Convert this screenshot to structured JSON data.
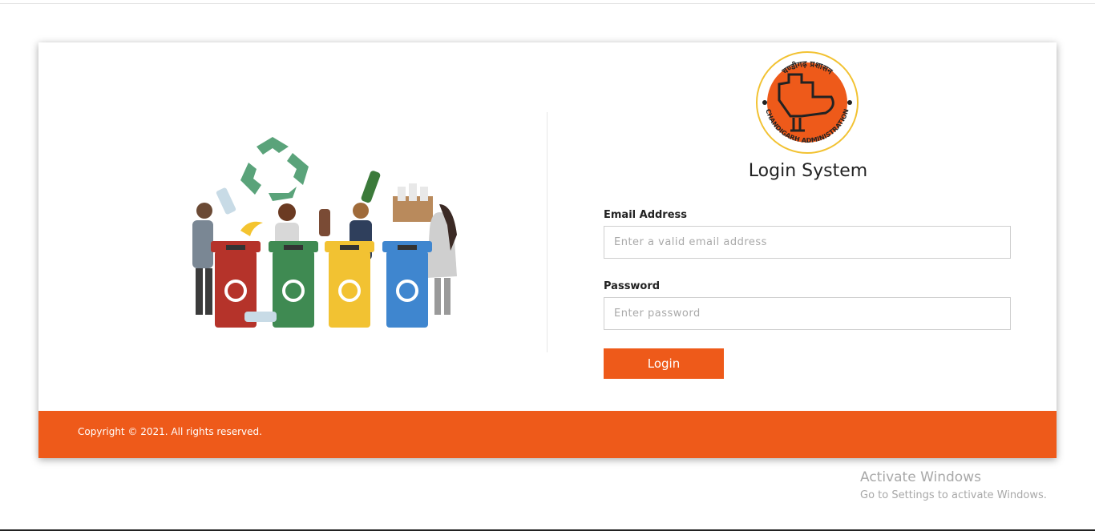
{
  "brand": {
    "logo_text_top": "चण्डीगढ़ प्रशासन",
    "logo_text_bottom": "CHANDIGARH ADMINISTRATION"
  },
  "login": {
    "title": "Login System",
    "email_label": "Email Address",
    "email_placeholder": "Enter a valid email address",
    "password_label": "Password",
    "password_placeholder": "Enter password",
    "button_label": "Login"
  },
  "footer": {
    "copyright": "Copyright © 2021. All rights reserved."
  },
  "watermark": {
    "line1": "Activate Windows",
    "line2": "Go to Settings to activate Windows."
  },
  "colors": {
    "accent": "#ee5a1a",
    "bin_red": "#b5332a",
    "bin_green": "#3f8a52",
    "bin_yellow": "#f2c232",
    "bin_blue": "#3f86cf"
  },
  "icons": {
    "illustration": "recycling-bins-illustration",
    "logo": "chandigarh-open-hand-emblem"
  }
}
